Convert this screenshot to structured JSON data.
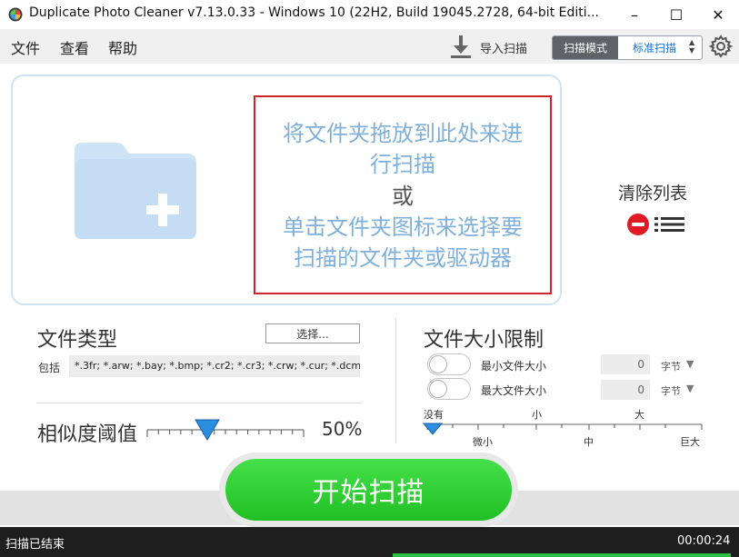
{
  "window": {
    "title": "Duplicate Photo Cleaner v7.13.0.33 - Windows 10 (22H2, Build 19045.2728, 64-bit Editi...",
    "minimize_glyph": "–",
    "maximize_glyph": "☐",
    "close_glyph": "✕"
  },
  "menu": {
    "file": "文件",
    "view": "查看",
    "help": "帮助",
    "import_scan": "导入扫描",
    "scan_mode_label": "扫描模式",
    "scan_mode_value": "标准扫描"
  },
  "dropzone": {
    "line1": "将文件夹拖放到此处来进",
    "line2": "行扫描",
    "or": "或",
    "line3": "单击文件夹图标来选择要",
    "line4": "扫描的文件夹或驱动器"
  },
  "clear_list": {
    "label": "清除列表"
  },
  "file_types": {
    "title": "文件类型",
    "select_button": "选择...",
    "include_label": "包括",
    "extensions": "*.3fr; *.arw; *.bay; *.bmp; *.cr2; *.cr3; *.crw; *.cur; *.dcm;"
  },
  "similarity": {
    "title": "相似度阈值",
    "value": "50%",
    "level": 0.5
  },
  "file_size": {
    "title": "文件大小限制",
    "min_label": "最小文件大小",
    "max_label": "最大文件大小",
    "min_value": "0",
    "max_value": "0",
    "unit": "字节",
    "min_enabled": false,
    "max_enabled": false,
    "top_labels": [
      "没有",
      "小",
      "大"
    ],
    "bottom_labels": [
      "微小",
      "中",
      "巨大"
    ]
  },
  "start": {
    "label": "开始扫描"
  },
  "status": {
    "text": "扫描已结束",
    "time": "00:00:24"
  },
  "colors": {
    "accent_blue": "#1a73c8",
    "drop_text": "#7fb0d9",
    "highlight_red": "#d0242b",
    "start_green": "#2fcf33",
    "clear_red": "#e01b24"
  }
}
